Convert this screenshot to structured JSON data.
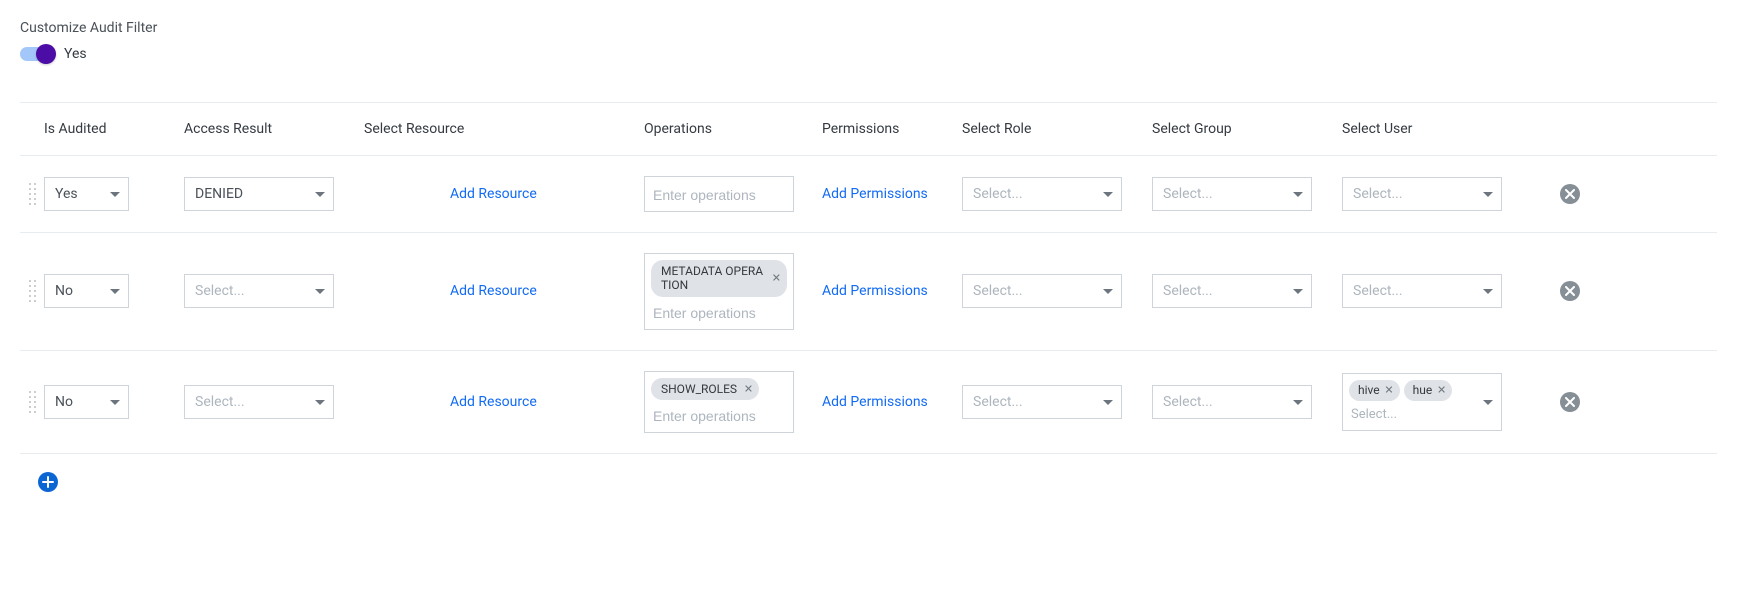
{
  "title": "Customize Audit Filter",
  "toggle": {
    "label": "Yes",
    "on": true
  },
  "headers": {
    "is_audited": "Is Audited",
    "access_result": "Access Result",
    "select_resource": "Select Resource",
    "operations": "Operations",
    "permissions": "Permissions",
    "select_role": "Select Role",
    "select_group": "Select Group",
    "select_user": "Select User"
  },
  "common": {
    "select_placeholder": "Select...",
    "add_resource": "Add Resource",
    "add_permissions": "Add Permissions",
    "operations_placeholder": "Enter operations"
  },
  "rows": [
    {
      "is_audited": "Yes",
      "access_result": "DENIED",
      "operations": [],
      "users": []
    },
    {
      "is_audited": "No",
      "access_result": "",
      "operations": [
        "METADATA OPERATION"
      ],
      "users": []
    },
    {
      "is_audited": "No",
      "access_result": "",
      "operations": [
        "SHOW_ROLES"
      ],
      "users": [
        "hive",
        "hue"
      ]
    }
  ]
}
